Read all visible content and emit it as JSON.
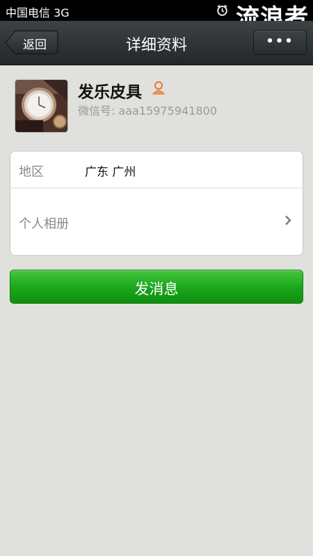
{
  "status_bar": {
    "carrier": "中国电信 3G",
    "watermark": "流浪者"
  },
  "header": {
    "back_label": "返回",
    "title": "详细资料",
    "more_label": "•••"
  },
  "profile": {
    "nickname": "发乐皮具",
    "wechat_id": "微信号: aaa15975941800"
  },
  "info": {
    "region_label": "地区",
    "region_value": "广东  广州",
    "album_label": "个人相册"
  },
  "actions": {
    "send_label": "发消息"
  },
  "colors": {
    "header_bg": "#2d3134",
    "send_green": "#19a51b",
    "page_bg": "#e0e0dc"
  }
}
